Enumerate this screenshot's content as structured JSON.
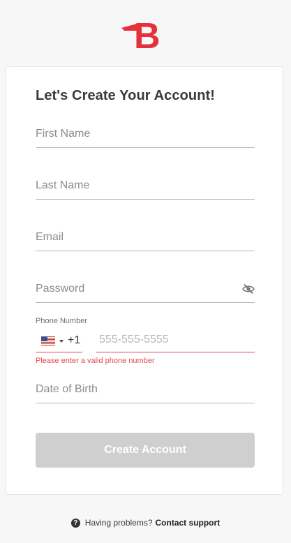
{
  "brand": {
    "logo_letter": "B",
    "logo_color": "#e5313a"
  },
  "signup": {
    "title": "Let's Create Your Account!",
    "first_name_placeholder": "First Name",
    "last_name_placeholder": "Last Name",
    "email_placeholder": "Email",
    "password_placeholder": "Password",
    "phone_label": "Phone Number",
    "country_code": "+1",
    "phone_placeholder": "555-555-5555",
    "phone_error": "Please enter a valid phone number",
    "dob_placeholder": "Date of Birth",
    "submit_label": "Create Account"
  },
  "footer": {
    "help_text": "Having problems?",
    "help_link": "Contact support"
  },
  "colors": {
    "error": "#e2494f",
    "button_disabled": "#cfcfcf"
  }
}
